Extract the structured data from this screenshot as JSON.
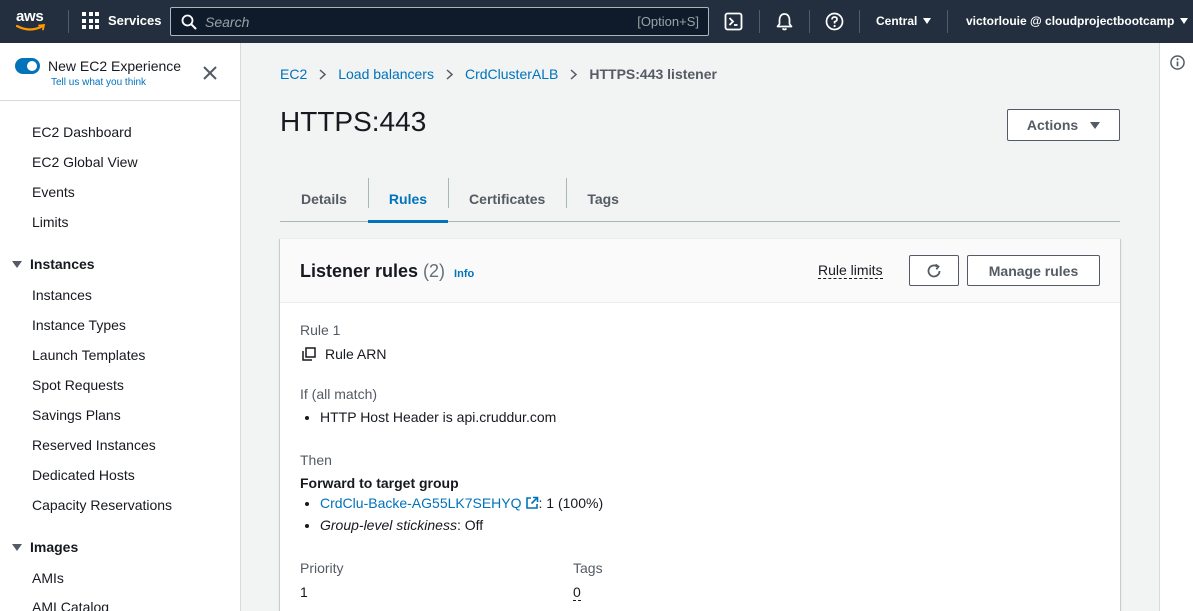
{
  "topnav": {
    "logo_text": "aws",
    "services_label": "Services",
    "search_placeholder": "Search",
    "search_shortcut": "[Option+S]",
    "region": "Central",
    "user": "victorlouie @ cloudprojectbootcamp"
  },
  "sidebar": {
    "experience_title": "New EC2 Experience",
    "experience_link": "Tell us what you think",
    "links": [
      "EC2 Dashboard",
      "EC2 Global View",
      "Events",
      "Limits"
    ],
    "instances_section": {
      "heading": "Instances",
      "items": [
        "Instances",
        "Instance Types",
        "Launch Templates",
        "Spot Requests",
        "Savings Plans",
        "Reserved Instances",
        "Dedicated Hosts",
        "Capacity Reservations"
      ]
    },
    "images_section": {
      "heading": "Images",
      "items": [
        "AMIs",
        "AMI Catalog"
      ]
    }
  },
  "breadcrumb": [
    "EC2",
    "Load balancers",
    "CrdClusterALB",
    "HTTPS:443 listener"
  ],
  "page_title": "HTTPS:443",
  "actions_label": "Actions",
  "tabs": [
    "Details",
    "Rules",
    "Certificates",
    "Tags"
  ],
  "listener_rules": {
    "title": "Listener rules",
    "count": "(2)",
    "info_label": "Info",
    "rule_limits_label": "Rule limits",
    "manage_rules_label": "Manage rules",
    "rule_name": "Rule 1",
    "rule_arn_label": "Rule ARN",
    "if_label": "If (all match)",
    "condition": "HTTP Host Header is api.cruddur.com",
    "then_label": "Then",
    "action_title": "Forward to target group",
    "target_group": "CrdClu-Backe-AG55LK7SEHYQ",
    "target_weight": ": 1 (100%)",
    "stickiness_label": "Group-level stickiness",
    "stickiness_value": ": Off",
    "priority_label": "Priority",
    "priority_value": "1",
    "tags_label": "Tags",
    "tags_value": "0"
  },
  "colors": {
    "nav_bg": "#232f3e",
    "link": "#0073bb",
    "text": "#16191f",
    "page_bg": "#f2f3f3"
  }
}
